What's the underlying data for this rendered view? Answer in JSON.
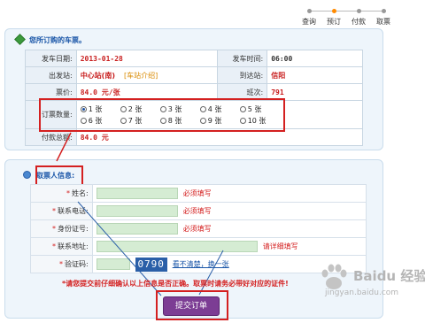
{
  "steps": [
    {
      "label": "查询",
      "active": false
    },
    {
      "label": "预订",
      "active": true
    },
    {
      "label": "付款",
      "active": false
    },
    {
      "label": "取票",
      "active": false
    }
  ],
  "ticket_panel": {
    "title": "您所订购的车票。",
    "depart_date_label": "发车日期:",
    "depart_date": "2013-01-28",
    "depart_time_label": "发车时间:",
    "depart_time": "06:00",
    "from_label": "出发站:",
    "from_station": "中心站(南)",
    "station_intro_link": "[车站介绍]",
    "to_label": "到达站:",
    "to_station": "信阳",
    "price_label": "票价:",
    "price": "84.0 元/张",
    "bus_no_label": "班次:",
    "bus_no": "791",
    "qty_label": "订票数量:",
    "qty_options": [
      "1 张",
      "2 张",
      "3 张",
      "4 张",
      "5 张",
      "6 张",
      "7 张",
      "8 张",
      "9 张",
      "10 张"
    ],
    "qty_selected": "1 张",
    "total_label": "付款总额:",
    "total": "84.0 元"
  },
  "pickup_panel": {
    "title": "取票人信息:",
    "fields": [
      {
        "label": "姓名:",
        "hint": "必须填写"
      },
      {
        "label": "联系电话:",
        "hint": "必须填写"
      },
      {
        "label": "身份证号:",
        "hint": "必须填写"
      },
      {
        "label": "联系地址:",
        "hint": "请详细填写"
      }
    ],
    "captcha_label": "验证码:",
    "captcha_code": "0790",
    "captcha_refresh": "看不清楚，换一张",
    "warning": "*请您提交前仔细确认以上信息是否正确。取票时请务必带好对应的证件!",
    "submit_label": "提交订单"
  },
  "watermark": {
    "title": "Baidu 经验",
    "url": "jingyan.baidu.com"
  },
  "colors": {
    "accent_red": "#d42020",
    "panel_bg": "#eef5fb",
    "submit_bg": "#7c3d94",
    "step_active": "#ff8a00"
  }
}
